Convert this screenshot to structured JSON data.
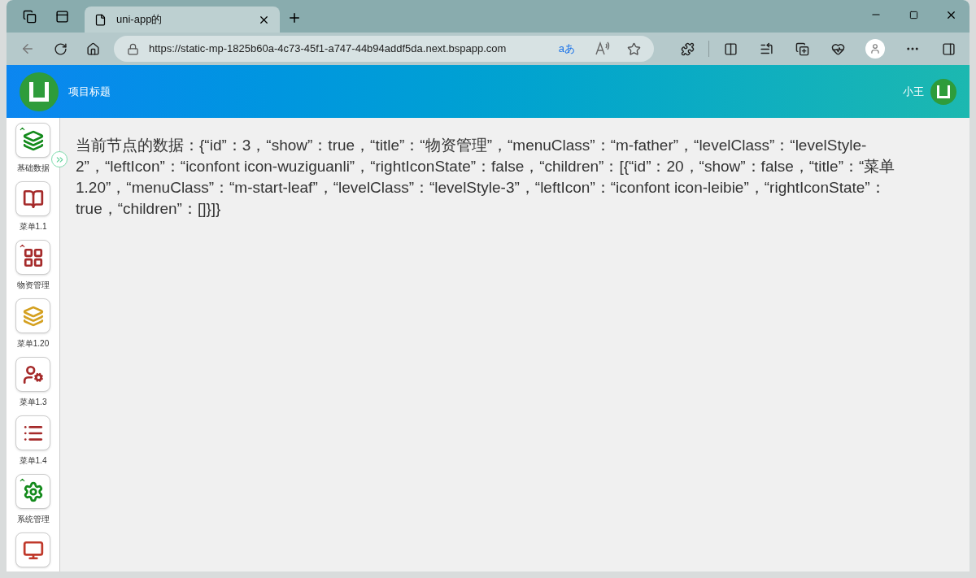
{
  "browser": {
    "tab": {
      "title": "uni-app的",
      "selected": true
    },
    "url": "https://static-mp-1825b60a-4c73-45f1-a747-44b94addf5da.next.bspapp.com",
    "translate_label": "aあ"
  },
  "header": {
    "title": "项目标题",
    "user": "小王"
  },
  "sidebar": {
    "items": [
      {
        "label": "基础数据",
        "kind": "layers",
        "color": "#138a1b",
        "collapsible": true
      },
      {
        "label": "菜单1.1",
        "kind": "books",
        "color": "#a52a2a",
        "collapsible": false
      },
      {
        "label": "物资管理",
        "kind": "grid",
        "color": "#a52a2a",
        "collapsible": true
      },
      {
        "label": "菜单1.20",
        "kind": "layers",
        "color": "#d4a020",
        "collapsible": false
      },
      {
        "label": "菜单1.3",
        "kind": "agent",
        "color": "#a52a2a",
        "collapsible": false
      },
      {
        "label": "菜单1.4",
        "kind": "list",
        "color": "#a52a2a",
        "collapsible": false
      },
      {
        "label": "系统管理",
        "kind": "gear",
        "color": "#138a1b",
        "collapsible": true
      },
      {
        "kind": "monitor",
        "color": "#c0392b",
        "collapsible": false
      }
    ]
  },
  "content": {
    "text": "当前节点的数据：{“id”：3，“show”：true，“title”：“物资管理”，“menuClass”：“m-father”，“levelClass”：“levelStyle-2”，“leftIcon”：“iconfont icon-wuziguanli”，“rightIconState”：false，“children”：[{“id”：20，“show”：false，“title”：“菜单1.20”，“menuClass”：“m-start-leaf”，“levelClass”：“levelStyle-3”，“leftIcon”：“iconfont icon-leibie”，“rightIconState”：true，“children”：[]}]}"
  }
}
